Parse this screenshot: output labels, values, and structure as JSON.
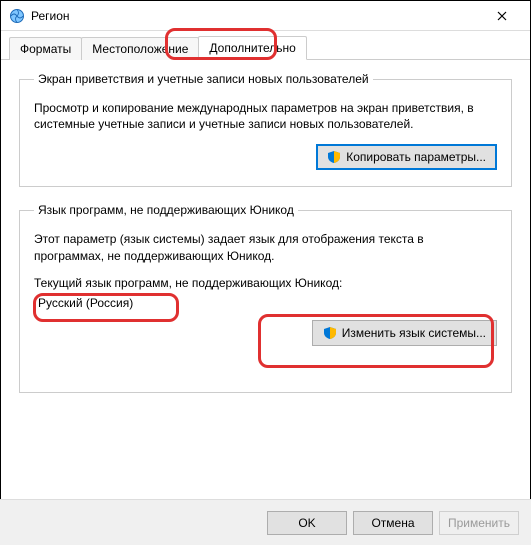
{
  "window": {
    "title": "Регион"
  },
  "tabs": {
    "formats": "Форматы",
    "location": "Местоположение",
    "advanced": "Дополнительно"
  },
  "group1": {
    "legend": "Экран приветствия и учетные записи новых пользователей",
    "desc": "Просмотр и копирование международных параметров на экран приветствия, в системные учетные записи и учетные записи новых пользователей.",
    "button": "Копировать параметры..."
  },
  "group2": {
    "legend": "Язык программ, не поддерживающих Юникод",
    "desc": "Этот параметр (язык системы) задает язык для отображения текста в программах, не поддерживающих Юникод.",
    "subhead": "Текущий язык программ, не поддерживающих Юникод:",
    "value": "Русский (Россия)",
    "button": "Изменить язык системы..."
  },
  "footer": {
    "ok": "OK",
    "cancel": "Отмена",
    "apply": "Применить"
  }
}
